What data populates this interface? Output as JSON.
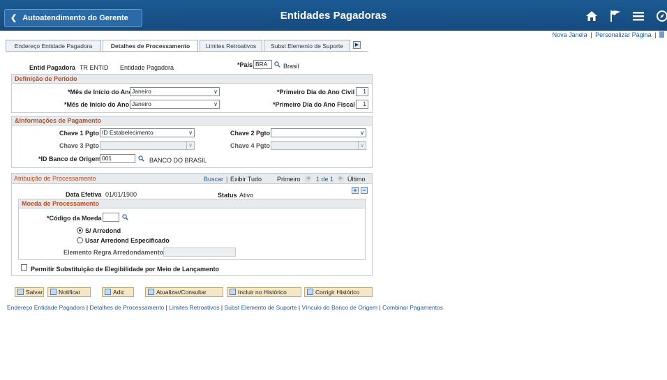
{
  "header": {
    "back_label": "Autoatendimento do Gerente",
    "title": "Entidades Pagadoras",
    "icons": [
      "home-icon",
      "flag-icon",
      "menu-icon",
      "navbar-icon"
    ]
  },
  "top_links": {
    "new_window": "Nova Janela",
    "personalize": "Personalizar Página",
    "sep": "|"
  },
  "tabs": [
    {
      "label": "Endereço Entidade Pagadora",
      "active": false
    },
    {
      "label": "Detalhes de Processamento",
      "active": true
    },
    {
      "label": "Limites Retroativos",
      "active": false
    },
    {
      "label": "Subst Elemento de Suporte",
      "active": false
    }
  ],
  "entity": {
    "entid_label": "Entid Pagadora",
    "entid_value": "TR ENTID",
    "entid_desc": "Entidade Pagadora",
    "pais_label": "*País",
    "pais_value": "BRA",
    "pais_desc": "Brasil"
  },
  "periodo": {
    "title": "Definição de Período",
    "mes_civil_label": "*Mês de Início do Ano Civil",
    "mes_civil_value": "Janeiro",
    "mes_fiscal_label": "*Mês de Início do Ano Fiscal",
    "mes_fiscal_value": "Janeiro",
    "dia_civil_label": "*Primeiro Dia do Ano Civil",
    "dia_civil_value": "1",
    "dia_fiscal_label": "*Primeiro Dia do Ano Fiscal",
    "dia_fiscal_value": "1"
  },
  "pagamento": {
    "title": "&Informações de Pagamento",
    "chave1_label": "Chave 1 Pgto",
    "chave1_value": "ID Estabelecimento",
    "chave2_label": "Chave 2 Pgto",
    "chave2_value": "",
    "chave3_label": "Chave 3 Pgto",
    "chave3_value": "",
    "chave4_label": "Chave 4 Pgto",
    "chave4_value": "",
    "banco_label": "*ID Banco de Origem",
    "banco_value": "001",
    "banco_desc": "BANCO DO BRASIL"
  },
  "atribuicao": {
    "title": "Atribuição de Processamento",
    "buscar": "Buscar",
    "exibir_tudo": "Exibir Tudo",
    "sep": "|",
    "primeiro": "Primeiro",
    "paging": "1 de 1",
    "ultimo": "Último",
    "data_label": "Data Efetiva",
    "data_value": "01/01/1900",
    "status_label": "Status",
    "status_value": "Ativo",
    "plus": "+",
    "minus": "−"
  },
  "moeda": {
    "title": "Moeda de Processamento",
    "codigo_label": "*Código da Moeda",
    "codigo_value": "",
    "opt1": "S/ Arredond",
    "opt2": "Usar Arredond Especificado",
    "selected": "S/ Arredond",
    "regra_label": "Elemento Regra Arredondamento",
    "regra_value": ""
  },
  "permitir": {
    "label": "Permitir Substituição de Elegibilidade por Meio de Lançamento",
    "checked": false
  },
  "buttons": {
    "salvar": "Salvar",
    "notificar": "Notificar",
    "adic": "Adic",
    "atualizar": "Atualizar/Consultar",
    "incluir": "Incluir no Histórico",
    "corrigir": "Corrigir Histórico"
  },
  "footer_links": [
    "Endereço Entidade Pagadora",
    "Detalhes de Processamento",
    "Limites Retroativos",
    "Subst Elemento de Suporte",
    "Vínculo do Banco de Origem",
    "Combinar Pagamentos"
  ],
  "footer_sep": "|",
  "colors": {
    "header": "#1c5a93",
    "section_title": "#b84a1f",
    "link": "#1f5b9a",
    "button": "#f3e7c8"
  }
}
